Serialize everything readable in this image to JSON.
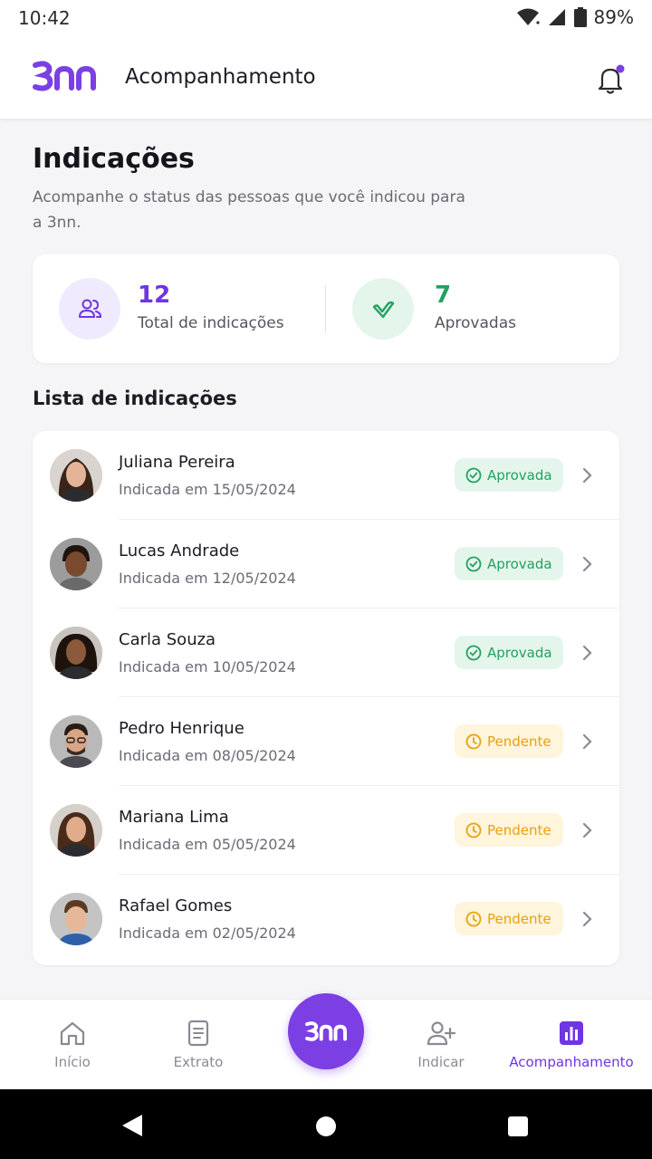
{
  "status_bar": {
    "time": "10:42",
    "battery": "89%"
  },
  "app_bar": {
    "logo_text": "3nn",
    "title": "Acompanhamento"
  },
  "page": {
    "heading": "Indicações",
    "subtitle": "Acompanhe o status das pessoas que você indicou para a 3nn."
  },
  "stats": {
    "total": {
      "value": "12",
      "label": "Total de indicações"
    },
    "approved": {
      "value": "7",
      "label": "Aprovadas"
    }
  },
  "list": {
    "title": "Lista de indicações",
    "items": [
      {
        "name": "Juliana Pereira",
        "date": "Indicada em 15/05/2024",
        "status": "Aprovada"
      },
      {
        "name": "Lucas Andrade",
        "date": "Indicada em 12/05/2024",
        "status": "Aprovada"
      },
      {
        "name": "Carla Souza",
        "date": "Indicada em 10/05/2024",
        "status": "Aprovada"
      },
      {
        "name": "Pedro Henrique",
        "date": "Indicada em 08/05/2024",
        "status": "Pendente"
      },
      {
        "name": "Mariana Lima",
        "date": "Indicada em 05/05/2024",
        "status": "Pendente"
      },
      {
        "name": "Rafael Gomes",
        "date": "Indicada em 02/05/2024",
        "status": "Pendente"
      }
    ]
  },
  "bottom_nav": {
    "items": [
      {
        "label": "Início",
        "icon": "home-icon"
      },
      {
        "label": "Extrato",
        "icon": "document-icon"
      },
      {
        "label": "3nn",
        "icon": "brand-logo"
      },
      {
        "label": "Indicar",
        "icon": "add-user-icon"
      },
      {
        "label": "Acompanhamento",
        "icon": "chart-icon"
      }
    ]
  },
  "colors": {
    "brand": "#7b3fe4",
    "approved": "#23a160",
    "pending": "#e8a20e"
  }
}
